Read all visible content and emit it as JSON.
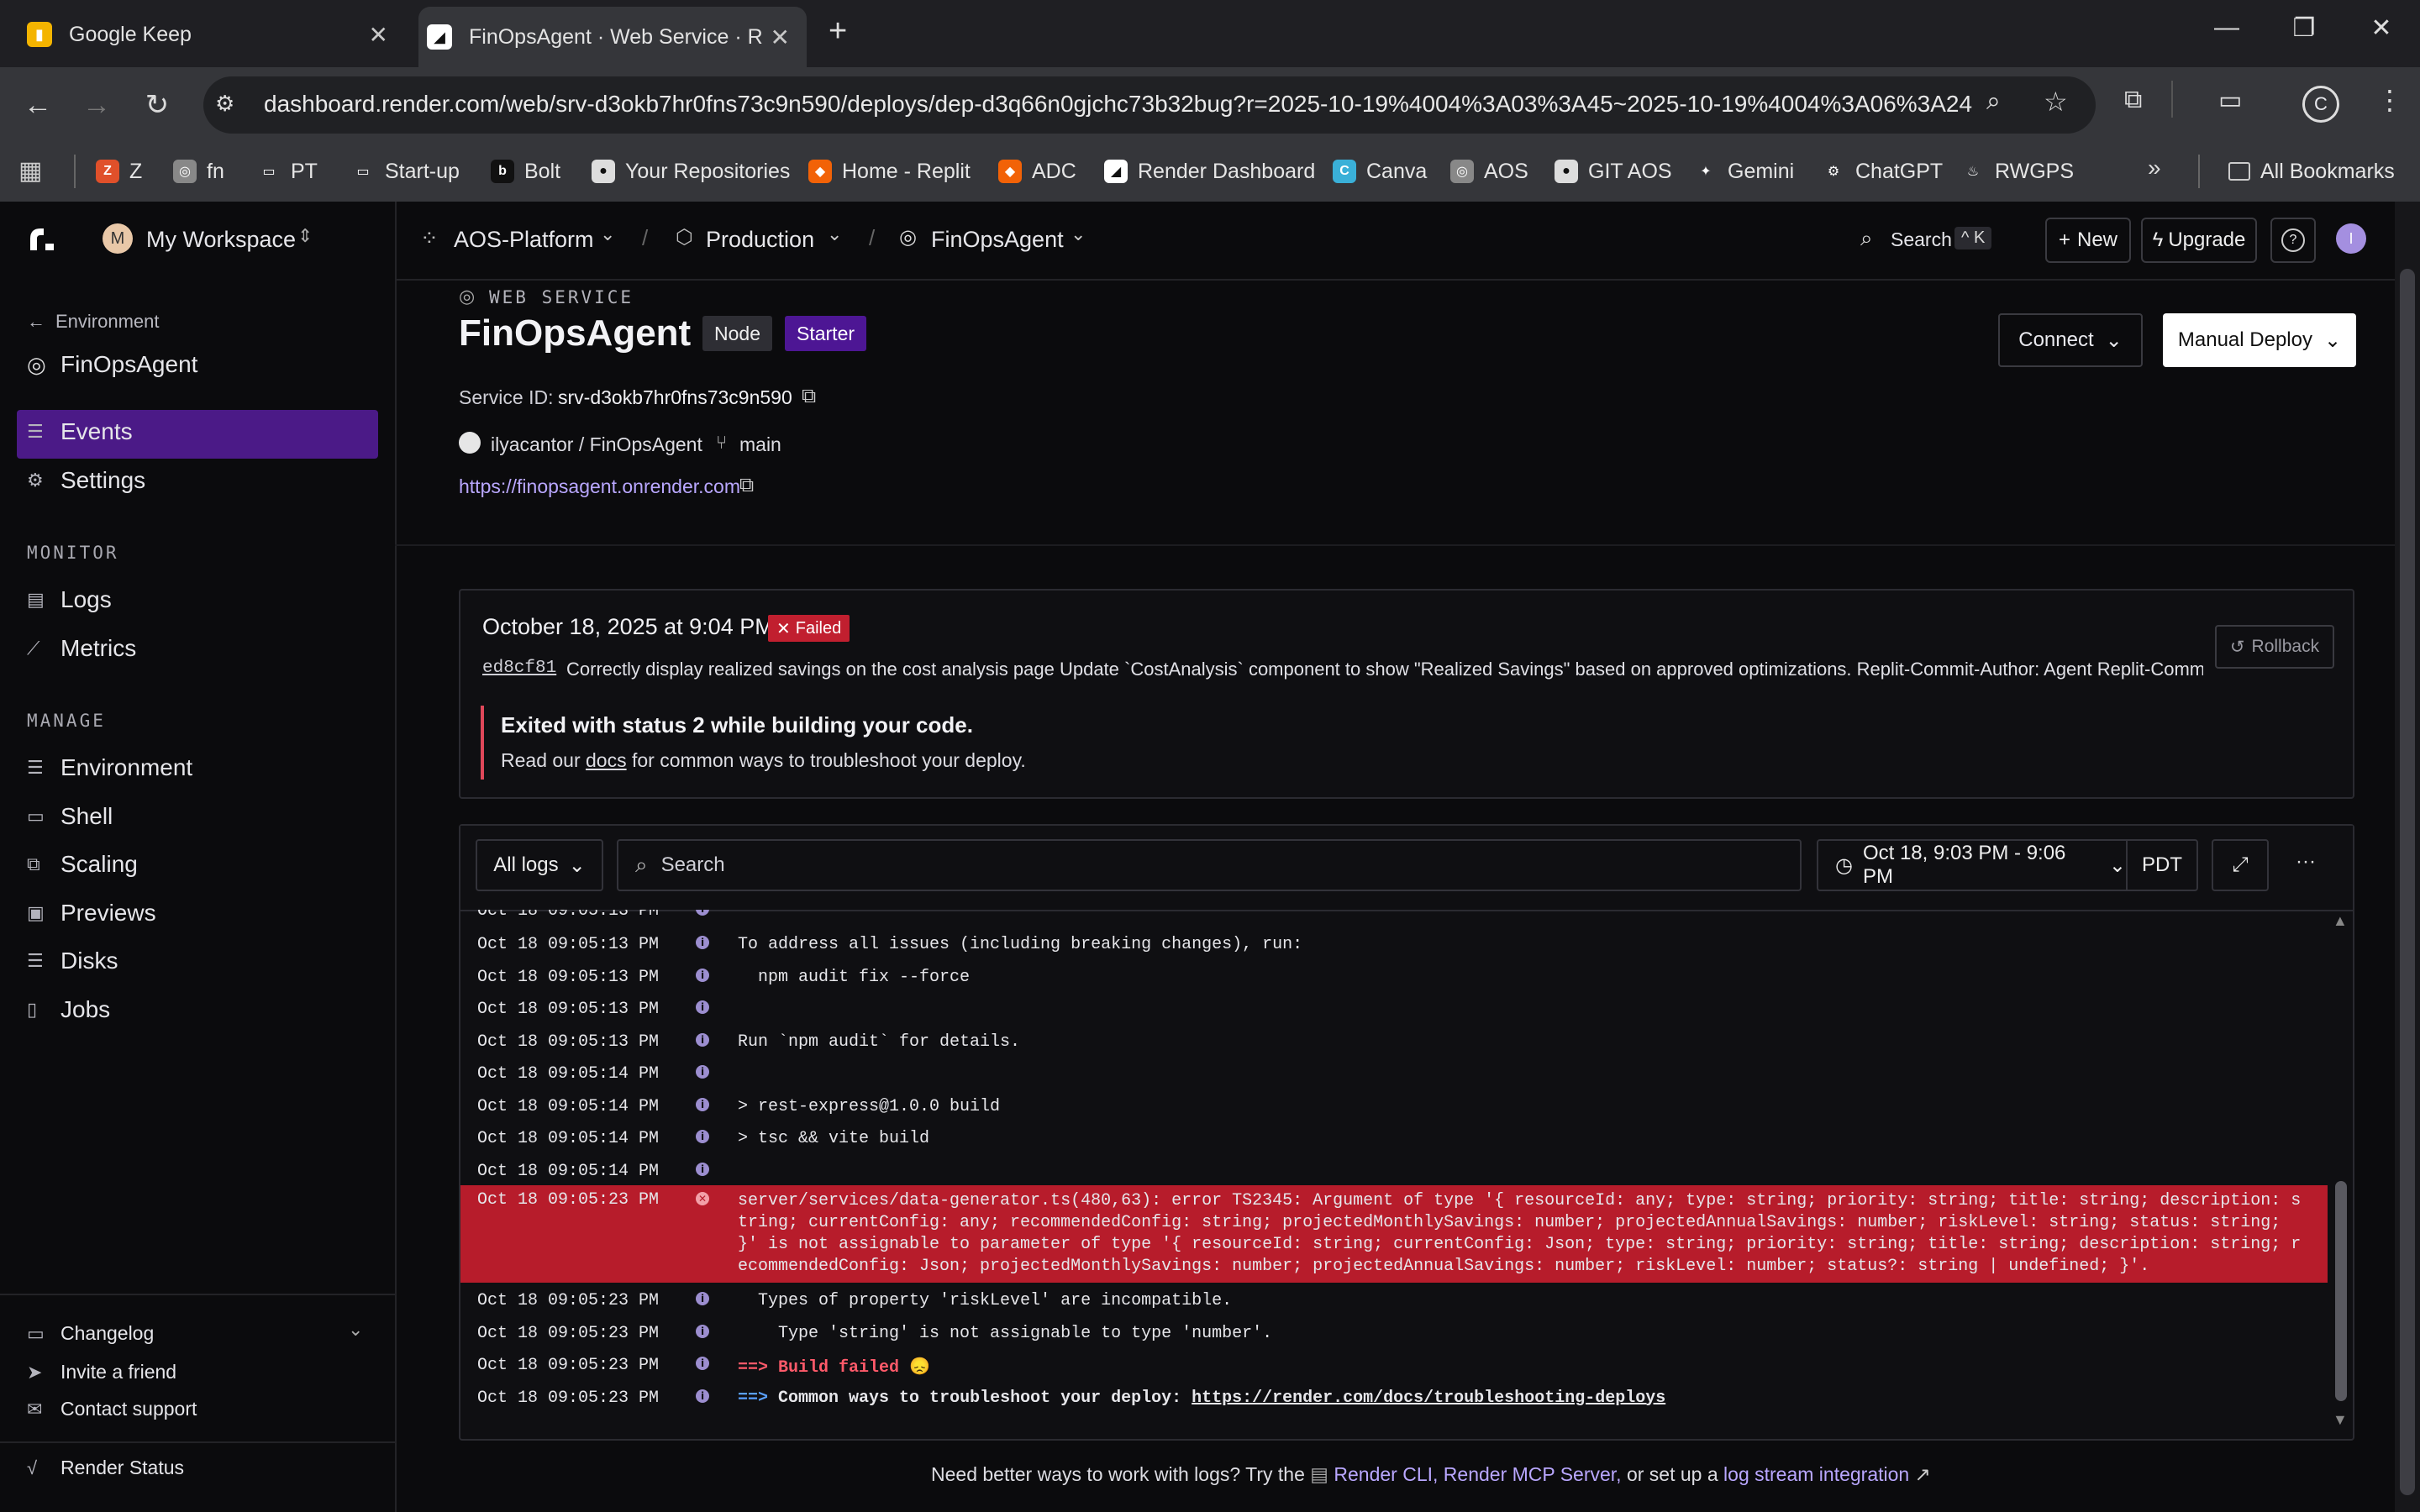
{
  "browser": {
    "tabs": [
      {
        "title": "Google Keep",
        "icon": "keep-icon"
      },
      {
        "title": "FinOpsAgent · Web Service · R",
        "icon": "render-icon"
      }
    ],
    "url": "dashboard.render.com/web/srv-d3okb7hr0fns73c9n590/deploys/dep-d3q66n0gjchc73b32bug?r=2025-10-19%4004%3A03%3A45~2025-10-19%4004%3A06%3A24",
    "bookmarks": [
      "Z",
      "fn",
      "PT",
      "Start-up",
      "Bolt",
      "Your Repositories",
      "Home - Replit",
      "ADC",
      "Render Dashboard",
      "Canva",
      "AOS",
      "GIT AOS",
      "Gemini",
      "ChatGPT",
      "RWGPS"
    ],
    "all_bookmarks": "All Bookmarks",
    "profile_initial": "C"
  },
  "header": {
    "workspace_initial": "M",
    "workspace": "My Workspace",
    "breadcrumb": [
      "AOS-Platform",
      "Production",
      "FinOpsAgent"
    ],
    "search_label": "Search",
    "search_shortcut": "^ K",
    "new_label": "New",
    "upgrade_label": "Upgrade",
    "help_label": "?",
    "avatar_initial": "I"
  },
  "sidebar": {
    "back_label": "Environment",
    "service_name": "FinOpsAgent",
    "top_items": [
      "Events",
      "Settings"
    ],
    "monitor_title": "MONITOR",
    "monitor_items": [
      "Logs",
      "Metrics"
    ],
    "manage_title": "MANAGE",
    "manage_items": [
      "Environment",
      "Shell",
      "Scaling",
      "Previews",
      "Disks",
      "Jobs"
    ],
    "footer": [
      "Changelog",
      "Invite a friend",
      "Contact support",
      "Render Status"
    ]
  },
  "service": {
    "type_label": "WEB SERVICE",
    "name": "FinOpsAgent",
    "badges": [
      "Node",
      "Starter"
    ],
    "id_label": "Service ID:",
    "id": "srv-d3okb7hr0fns73c9n590",
    "repo": "ilyacantor / FinOpsAgent",
    "branch": "main",
    "url": "https://finopsagent.onrender.com",
    "connect_label": "Connect",
    "deploy_label": "Manual Deploy"
  },
  "deploy": {
    "date": "October 18, 2025 at 9:04 PM",
    "status": "Failed",
    "commit_hash": "ed8cf81",
    "commit_msg": "Correctly display realized savings on the cost analysis page Update `CostAnalysis` component to show \"Realized Savings\" based on approved optimizations. Replit-Commit-Author: Agent Replit-Commi...",
    "rollback_label": "Rollback",
    "error_title": "Exited with status 2 while building your code.",
    "error_pre": "Read our",
    "error_link": "docs",
    "error_post": "for common ways to troubleshoot your deploy."
  },
  "logs": {
    "filter": "All logs",
    "search_placeholder": "Search",
    "range": "Oct 18, 9:03 PM - 9:06 PM",
    "tz": "PDT",
    "more": "···",
    "rows": [
      {
        "t": "Oct 18 09:05:13 PM",
        "m": "To address all issues (including breaking changes), run:"
      },
      {
        "t": "Oct 18 09:05:13 PM",
        "m": "  npm audit fix --force"
      },
      {
        "t": "Oct 18 09:05:13 PM",
        "m": ""
      },
      {
        "t": "Oct 18 09:05:13 PM",
        "m": "Run `npm audit` for details."
      },
      {
        "t": "Oct 18 09:05:14 PM",
        "m": ""
      },
      {
        "t": "Oct 18 09:05:14 PM",
        "m": "> rest-express@1.0.0 build"
      },
      {
        "t": "Oct 18 09:05:14 PM",
        "m": "> tsc && vite build"
      },
      {
        "t": "Oct 18 09:05:14 PM",
        "m": ""
      }
    ],
    "error_row": {
      "t": "Oct 18 09:05:23 PM",
      "m": "server/services/data-generator.ts(480,63): error TS2345: Argument of type '{ resourceId: any; type: string; priority: string; title: string; description: string; currentConfig: any; recommendedConfig: string; projectedMonthlySavings: number; projectedAnnualSavings: number; riskLevel: string; status: string; }' is not assignable to parameter of type '{ resourceId: string; currentConfig: Json; type: string; priority: string; title: string; description: string; recommendedConfig: Json; projectedMonthlySavings: number; projectedAnnualSavings: number; riskLevel: number; status?: string | undefined; }'."
    },
    "after_rows": [
      {
        "t": "Oct 18 09:05:23 PM",
        "m": "  Types of property 'riskLevel' are incompatible."
      },
      {
        "t": "Oct 18 09:05:23 PM",
        "m": "    Type 'string' is not assignable to type 'number'."
      }
    ],
    "build_failed_prefix": "==>",
    "build_failed": "Build failed 😞",
    "troubleshoot_prefix": "==>",
    "troubleshoot_text": "Common ways to troubleshoot your deploy:",
    "troubleshoot_link": "https://render.com/docs/troubleshooting-deploys",
    "last_ts": "Oct 18 09:05:23 PM"
  },
  "footer": {
    "pre": "Need better ways to work with logs? Try the",
    "cli": "Render CLI,",
    "mcp": "Render MCP Server,",
    "mid": "or set up a",
    "integration": "log stream integration"
  }
}
